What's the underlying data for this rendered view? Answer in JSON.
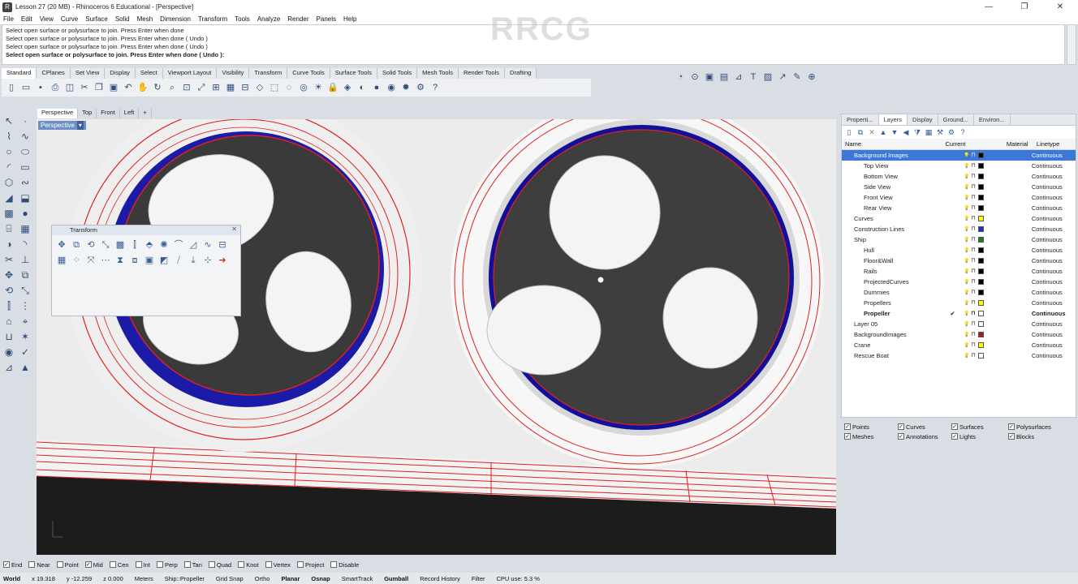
{
  "window": {
    "title": "Lesson 27 (20 MB) - Rhinoceros 6 Educational - [Perspective]",
    "minimize": "—",
    "restore": "❐",
    "close": "✕"
  },
  "menu": [
    "File",
    "Edit",
    "View",
    "Curve",
    "Surface",
    "Solid",
    "Mesh",
    "Dimension",
    "Transform",
    "Tools",
    "Analyze",
    "Render",
    "Panels",
    "Help"
  ],
  "command_history": [
    "Select open surface or polysurface to join. Press Enter when done",
    "Select open surface or polysurface to join. Press Enter when done ( Undo )",
    "Select open surface or polysurface to join. Press Enter when done ( Undo )"
  ],
  "command_prompt": "Select open surface or polysurface to join. Press Enter when done ( Undo ):",
  "watermark": "RRCG",
  "toolbar_tabs": [
    "Standard",
    "CPlanes",
    "Set View",
    "Display",
    "Select",
    "Viewport Layout",
    "Visibility",
    "Transform",
    "Curve Tools",
    "Surface Tools",
    "Solid Tools",
    "Mesh Tools",
    "Render Tools",
    "Drafting"
  ],
  "viewport_tabs": [
    "Perspective",
    "Top",
    "Front",
    "Left"
  ],
  "viewport_label": "Perspective",
  "viewport_add": "+",
  "viewport_menu_arrow": "▾",
  "float_panel": {
    "title": "Transform",
    "close": "✕"
  },
  "right_panel": {
    "tabs": [
      "Properti...",
      "Layers",
      "Display",
      "Ground...",
      "Environ..."
    ],
    "columns": {
      "name": "Name",
      "current": "Current",
      "material": "Material",
      "linetype": "Linetype"
    },
    "layers": [
      {
        "name": "Background Images",
        "level": 0,
        "selected": true,
        "color": "#000000",
        "linetype": "Continuous",
        "current": ""
      },
      {
        "name": "Top View",
        "level": 1,
        "color": "#000000",
        "linetype": "Continuous",
        "current": ""
      },
      {
        "name": "Bottom View",
        "level": 1,
        "color": "#000000",
        "linetype": "Continuous",
        "current": ""
      },
      {
        "name": "Side View",
        "level": 1,
        "color": "#000000",
        "linetype": "Continuous",
        "current": ""
      },
      {
        "name": "Front View",
        "level": 1,
        "color": "#000000",
        "linetype": "Continuous",
        "current": ""
      },
      {
        "name": "Rear View",
        "level": 1,
        "color": "#000000",
        "linetype": "Continuous",
        "current": ""
      },
      {
        "name": "Curves",
        "level": 0,
        "color": "#ffff00",
        "linetype": "Continuous",
        "current": ""
      },
      {
        "name": "Construction Lines",
        "level": 0,
        "color": "#1f2fbf",
        "linetype": "Continuous",
        "current": ""
      },
      {
        "name": "Ship",
        "level": 0,
        "color": "#1e7a1e",
        "linetype": "Continuous",
        "current": ""
      },
      {
        "name": "Hull",
        "level": 1,
        "color": "#000000",
        "linetype": "Continuous",
        "current": ""
      },
      {
        "name": "Floor&Wall",
        "level": 1,
        "color": "#000000",
        "linetype": "Continuous",
        "current": ""
      },
      {
        "name": "Rails",
        "level": 1,
        "color": "#000000",
        "linetype": "Continuous",
        "current": ""
      },
      {
        "name": "ProjectedCurves",
        "level": 1,
        "color": "#000000",
        "linetype": "Continuous",
        "current": ""
      },
      {
        "name": "Dummies",
        "level": 1,
        "color": "#000000",
        "linetype": "Continuous",
        "current": ""
      },
      {
        "name": "Propellers",
        "level": 1,
        "color": "#ffff00",
        "linetype": "Continuous",
        "current": ""
      },
      {
        "name": "Propeller",
        "level": 1,
        "bold": true,
        "color": "#ffffff",
        "linetype": "Continuous",
        "current": "✔"
      },
      {
        "name": "Layer 05",
        "level": 0,
        "color": "#ffffff",
        "linetype": "Continuous",
        "current": ""
      },
      {
        "name": "BackgroundImages",
        "level": 0,
        "color": "#b01919",
        "linetype": "Continuous",
        "current": ""
      },
      {
        "name": "Crane",
        "level": 0,
        "color": "#ffff00",
        "linetype": "Continuous",
        "current": ""
      },
      {
        "name": "Rescue Boat",
        "level": 0,
        "color": "#ffffff",
        "linetype": "Continuous",
        "current": ""
      }
    ]
  },
  "filters": [
    {
      "label": "Points",
      "checked": true
    },
    {
      "label": "Curves",
      "checked": true
    },
    {
      "label": "Surfaces",
      "checked": true
    },
    {
      "label": "Polysurfaces",
      "checked": true
    },
    {
      "label": "Meshes",
      "checked": true
    },
    {
      "label": "Annotations",
      "checked": true
    },
    {
      "label": "Lights",
      "checked": true
    },
    {
      "label": "Blocks",
      "checked": true
    }
  ],
  "osnap": [
    {
      "label": "End",
      "checked": true
    },
    {
      "label": "Near",
      "checked": false
    },
    {
      "label": "Point",
      "checked": false
    },
    {
      "label": "Mid",
      "checked": true
    },
    {
      "label": "Cen",
      "checked": false
    },
    {
      "label": "Int",
      "checked": false
    },
    {
      "label": "Perp",
      "checked": false
    },
    {
      "label": "Tan",
      "checked": false
    },
    {
      "label": "Quad",
      "checked": false
    },
    {
      "label": "Knot",
      "checked": false
    },
    {
      "label": "Vertex",
      "checked": false
    },
    {
      "label": "Project",
      "checked": false
    },
    {
      "label": "Disable",
      "checked": false
    }
  ],
  "status": {
    "cplane": "World",
    "x": "x 19.318",
    "y": "y -12.259",
    "z": "z 0.000",
    "units": "Meters",
    "layer": "Ship::Propeller",
    "grid_snap": "Grid Snap",
    "ortho": "Ortho",
    "planar": "Planar",
    "osnap": "Osnap",
    "smarttrack": "SmartTrack",
    "gumball": "Gumball",
    "record_history": "Record History",
    "filter": "Filter",
    "cpu": "CPU use: 5.3 %"
  }
}
